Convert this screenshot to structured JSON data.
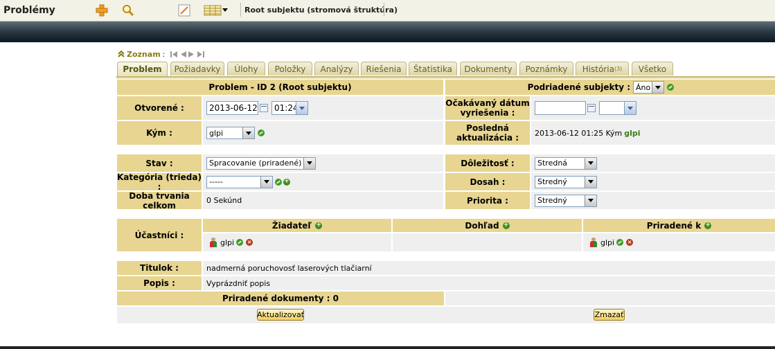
{
  "header": {
    "app_title": "Problémy",
    "root_label": "Root subjektu (stromová štruktúra)",
    "icons": [
      "add-icon",
      "search-icon",
      "edit-icon",
      "list-view-icon"
    ]
  },
  "nav": {
    "link": "Zoznam",
    "colon": ":"
  },
  "tabs": [
    {
      "label": "Problem",
      "active": true
    },
    {
      "label": "Požiadavky"
    },
    {
      "label": "Úlohy"
    },
    {
      "label": "Položky"
    },
    {
      "label": "Analýzy"
    },
    {
      "label": "Riešenia"
    },
    {
      "label": "Štatistika"
    },
    {
      "label": "Dokumenty"
    },
    {
      "label": "Poznámky"
    },
    {
      "label": "História",
      "sup": "(3)"
    },
    {
      "label": "Všetko"
    }
  ],
  "form": {
    "title": "Problem - ID 2 (Root subjektu)",
    "child_subjects_label": "Podriadené subjekty :",
    "child_subjects_value": "Áno",
    "opened_label": "Otvorené :",
    "opened_date": "2013-06-12",
    "opened_time": "01:24",
    "expected_label": "Očakávaný dátum vyriešenia :",
    "by_label": "Kým  :",
    "by_value": "glpi",
    "last_update_label": "Posledná aktualizácia :",
    "last_update_text": "2013-06-12 01:25 Kým",
    "last_update_user": "glpi",
    "status_label": "Stav :",
    "status_value": "Spracovanie (priradené)",
    "importance_label": "Dôležitosť :",
    "importance_value": "Stredná",
    "category_label": "Kategória (trieda) :",
    "category_value": "-----",
    "reach_label": "Dosah :",
    "reach_value": "Stredný",
    "duration_label": "Doba trvania celkom",
    "duration_value": "0 Sekúnd",
    "priority_label": "Priorita :",
    "priority_value": "Stredný",
    "participants_label": "Účastníci :",
    "requester_label": "Žiadateľ",
    "observer_label": "Dohľad",
    "assigned_label": "Priradené k",
    "requester_user": "glpi",
    "assigned_user": "glpi",
    "subject_label": "Titulok :",
    "subject_value": "nadmerná poruchovosť laserových tlačiarní",
    "desc_label": "Popis :",
    "desc_value": "Vyprázdniť popis",
    "docs_label": "Priradené dokumenty : 0",
    "update_button": "Aktualizovať",
    "delete_button": "Zmazať"
  },
  "colors": {
    "header_cell": "#e7d591",
    "value_cell": "#efefef",
    "accent": "#8a7a10"
  }
}
